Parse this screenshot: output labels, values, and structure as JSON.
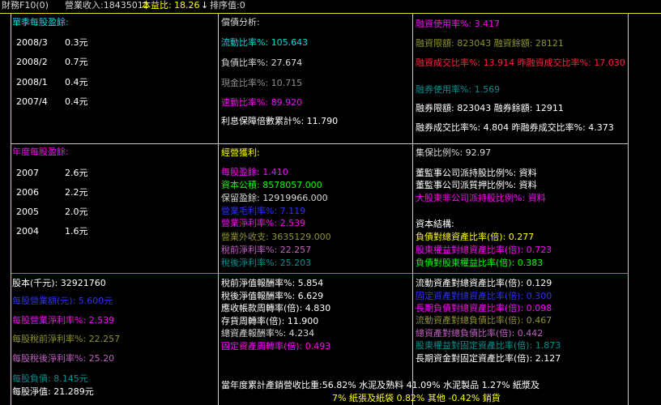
{
  "titlebar": {
    "app": "財務F10(0)",
    "revenue": "營業收入:18435012",
    "pe_label": "本益比:",
    "pe_value": "18.26",
    "arrow": "↓",
    "rank": "排序值:0"
  },
  "quarterly": {
    "title": "單季每股盈餘:",
    "rows": [
      {
        "period": "2008/3",
        "value": "0.3元"
      },
      {
        "period": "2008/2",
        "value": "0.7元"
      },
      {
        "period": "2008/1",
        "value": "0.4元"
      },
      {
        "period": "2007/4",
        "value": "0.4元"
      }
    ]
  },
  "debt": {
    "title": "償債分析:",
    "current_ratio": "流動比率%: 105.643",
    "debt_ratio": "負債比率%: 27.674",
    "cash_ratio": "現金比率%: 10.715",
    "quick_ratio": "速動比率%: 89.920",
    "interest_cover": "利息保障倍數累計%: 11.790"
  },
  "margin": {
    "usage": "融資使用率%: 3.417",
    "limit": "融資限額: 823043  融資餘額: 28121",
    "trade_ratio": "融資成交比率%: 13.914 昨融資成交比率%: 17.030",
    "short_usage": "融券使用率%: 1.569",
    "short_limit": "融券限額: 823043  融券餘額: 12911",
    "short_trade": "融券成交比率%: 4.804 昨融券成交比率%: 4.373"
  },
  "annual": {
    "title": "年度每股盈餘:",
    "rows": [
      {
        "period": "2007",
        "value": "2.6元"
      },
      {
        "period": "2006",
        "value": "2.2元"
      },
      {
        "period": "2005",
        "value": "2.0元"
      },
      {
        "period": "2004",
        "value": "1.6元"
      }
    ]
  },
  "operating": {
    "title": "經營獲利:",
    "eps": "每股盈餘: 1.410",
    "capital": "資本公積: 8578057.000",
    "retained": "保留盈餘: 12919966.000",
    "gross": "營業毛利率%: 7.119",
    "op_margin": "營業淨利率%: 2.539",
    "non_op": "營業外收支: 3635129.000",
    "pretax": "稅前淨利率%: 22.257",
    "aftertax": "稅後淨利率%: 25.203"
  },
  "holding": {
    "collateral": "集保比例%: 92.97",
    "directors": "董監事公司派持股比例%: 資料",
    "pledge": "董監事公司派質押比例%: 資料",
    "major": "大股東非公司派持股比例%: 資料",
    "structure_title": "資本結構:",
    "debt_asset": "負債對總資產比率(倍): 0.277",
    "equity_asset": "股東權益對總資產比率(倍): 0.723",
    "debt_equity": "負債對股東權益比率(倍): 0.383"
  },
  "capital_block": {
    "share_capital": "股本(千元): 32921760",
    "rev_per_share": "每股營業額(元): 5.600元",
    "op_per_share": "每股營業淨利率%: 2.539",
    "pretax_per_share": "每股稅前淨利率%: 22.257",
    "aftertax_per_share": "每股稅後淨利率%: 25.20",
    "liab_per_share": "每股負債: 8.145元",
    "nav_per_share": "每股淨值: 21.289元"
  },
  "returns": {
    "pretax_roe": "稅前淨值報酬率%: 5.854",
    "aftertax_roe": "稅後淨值報酬率%: 6.629",
    "ar_turnover": "應收帳款周轉率(倍): 4.830",
    "inv_turnover": "存貨周轉率(倍): 11.900",
    "roa": "總資產報酬率%: 4.234",
    "fixed_turnover": "固定資產周轉率(倍): 0.493"
  },
  "asset_ratios": {
    "current_total": "流動資產對總資產比率(倍): 0.129",
    "fixed_total": "固定資產對總資產比率(倍): 0.300",
    "lt_liab_total": "長期負債對總資產比率(倍): 0.098",
    "cur_liab": "流動資產對總負債比率(倍): 0.467",
    "total_liab": "總資產對總負債比率(倍): 0.442",
    "equity_fixed": "股東權益對固定資產比率(倍): 1.873",
    "lt_fixed": "長期資金對固定資產比率(倍): 2.127"
  },
  "product_mix": {
    "line1": "當年度累計產銷營收比重:56.82%  水泥及熟料    41.09%  水泥製品      1.27%  紙漿及",
    "line2": "7%  紙張及紙袋    0.82%  其他    -0.42%  銷貨"
  },
  "colors": {
    "border_yellow": "#e0e020",
    "border_green": "#20c020",
    "background": "#000000"
  }
}
